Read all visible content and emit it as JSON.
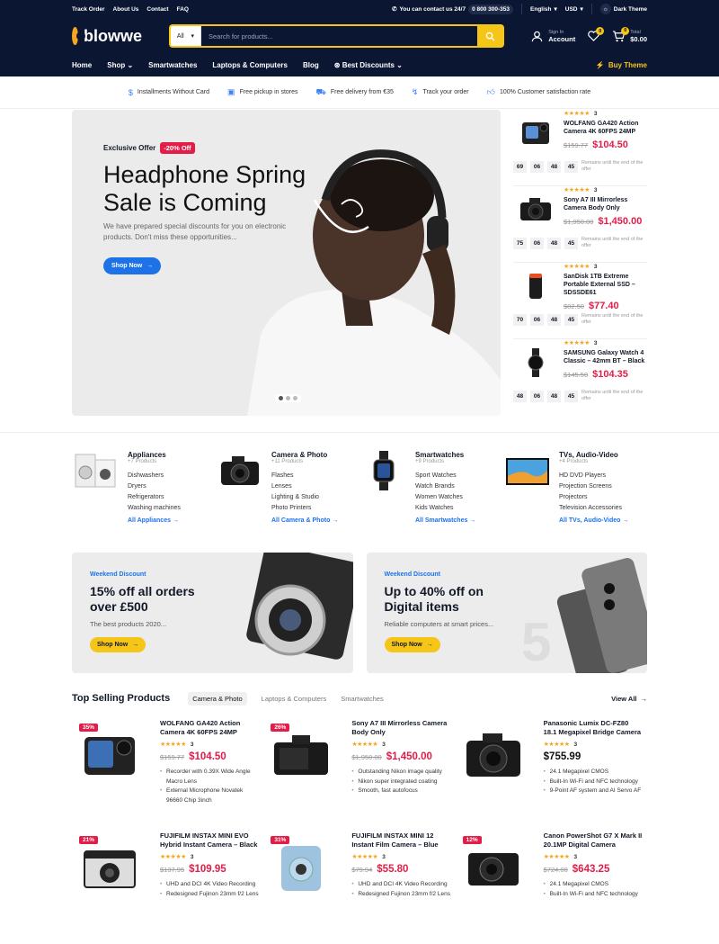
{
  "topbar": {
    "links": [
      "Track Order",
      "About Us",
      "Contact",
      "FAQ"
    ],
    "contact_text": "You can contact us 24/7",
    "phone": "0 800 300-353",
    "language": "English",
    "currency": "USD",
    "theme": "Dark Theme"
  },
  "header": {
    "logo": "blowwe",
    "search_category": "All",
    "search_placeholder": "Search for products...",
    "signin_small": "Sign In",
    "signin_big": "Account",
    "wishlist_count": "0",
    "cart_count": "0",
    "total_label": "Total",
    "total_value": "$0.00"
  },
  "nav": {
    "items": [
      "Home",
      "Shop",
      "Smartwatches",
      "Laptops & Computers",
      "Blog",
      "Best Discounts"
    ],
    "buy_theme": "Buy Theme"
  },
  "features": [
    "Installments Without Card",
    "Free pickup in stores",
    "Free delivery from €35",
    "Track your order",
    "100% Customer satisfaction rate"
  ],
  "hero": {
    "offer_label": "Exclusive Offer",
    "offer_tag": "-20% Off",
    "title": "Headphone Spring Sale is Coming",
    "desc": "We have prepared special discounts for you on electronic products. Don't miss these opportunities...",
    "button": "Shop Now"
  },
  "deals": [
    {
      "rating": "3",
      "name": "WOLFANG GA420 Action Camera 4K 60FPS 24MP",
      "old": "$159.77",
      "new": "$104.50",
      "timer": [
        "69",
        "06",
        "48",
        "45"
      ],
      "remaining": "Remains until the end of the offer"
    },
    {
      "rating": "3",
      "name": "Sony A7 III Mirrorless Camera Body Only",
      "old": "$1,950.00",
      "new": "$1,450.00",
      "timer": [
        "75",
        "06",
        "48",
        "45"
      ],
      "remaining": "Remains until the end of the offer"
    },
    {
      "rating": "3",
      "name": "SanDisk 1TB Extreme Portable External SSD – SDSSDE61",
      "old": "$82.50",
      "new": "$77.40",
      "timer": [
        "70",
        "06",
        "48",
        "45"
      ],
      "remaining": "Remains until the end of the offer"
    },
    {
      "rating": "3",
      "name": "SAMSUNG Galaxy Watch 4 Classic – 42mm BT – Black",
      "old": "$145.50",
      "new": "$104.35",
      "timer": [
        "48",
        "06",
        "48",
        "45"
      ],
      "remaining": "Remains until the end of the offer"
    }
  ],
  "categories": [
    {
      "title": "Appliances",
      "count": "+7 Products",
      "items": [
        "Dishwashers",
        "Dryers",
        "Refrigerators",
        "Washing machines"
      ],
      "all": "All Appliances"
    },
    {
      "title": "Camera & Photo",
      "count": "+11 Products",
      "items": [
        "Flashes",
        "Lenses",
        "Lighting & Studio",
        "Photo Printers"
      ],
      "all": "All Camera & Photo"
    },
    {
      "title": "Smartwatches",
      "count": "+9 Products",
      "items": [
        "Sport Watches",
        "Watch Brands",
        "Women Watches",
        "Kids Watches"
      ],
      "all": "All Smartwatches"
    },
    {
      "title": "TVs, Audio-Video",
      "count": "+4 Products",
      "items": [
        "HD DVD Players",
        "Projection Screens",
        "Projectors",
        "Television Accessories"
      ],
      "all": "All TVs, Audio-Video"
    }
  ],
  "banners": [
    {
      "label": "Weekend Discount",
      "title": "15% off all orders over £500",
      "desc": "The best products 2020...",
      "button": "Shop Now"
    },
    {
      "label": "Weekend Discount",
      "title": "Up to 40% off on Digital items",
      "desc": "Reliable computers at smart prices...",
      "button": "Shop Now"
    }
  ],
  "top_selling": {
    "title": "Top Selling Products",
    "tabs": [
      "Camera & Photo",
      "Laptops & Computers",
      "Smartwatches"
    ],
    "view_all": "View All",
    "products": [
      {
        "discount": "35%",
        "name": "WOLFANG GA420 Action Camera 4K 60FPS 24MP",
        "rating": "3",
        "old": "$159.77",
        "new": "$104.50",
        "features": [
          "Recorder with 0.39X Wide Angle Macro Lens",
          "External Microphone Novatek 96660 Chip 3inch"
        ]
      },
      {
        "discount": "26%",
        "name": "Sony A7 III Mirrorless Camera Body Only",
        "rating": "3",
        "old": "$1,950.00",
        "new": "$1,450.00",
        "features": [
          "Outstanding Nikon image quality",
          "Nikon super integrated coating",
          "Smooth, fast autofocus"
        ]
      },
      {
        "discount": "",
        "name": "Panasonic Lumix DC-FZ80 18.1 Megapixel Bridge Camera",
        "rating": "3",
        "old": "",
        "new": "$755.99",
        "features": [
          "24.1 Megapixel CMOS",
          "Built-In Wi-Fi and NFC technology",
          "9-Point AF system and AI Servo AF"
        ]
      },
      {
        "discount": "21%",
        "name": "FUJIFILM INSTAX MINI EVO Hybrid Instant Camera – Black",
        "rating": "3",
        "old": "$137.95",
        "new": "$109.95",
        "features": [
          "UHD and DCI 4K Video Recording",
          "Redesigned Fujinon 23mm f/2 Lens"
        ]
      },
      {
        "discount": "31%",
        "name": "FUJIFILM INSTAX MINI 12 Instant Film Camera – Blue",
        "rating": "3",
        "old": "$79.94",
        "new": "$55.80",
        "features": [
          "UHD and DCI 4K Video Recording",
          "Redesigned Fujinon 23mm f/2 Lens"
        ]
      },
      {
        "discount": "12%",
        "name": "Canon PowerShot G7 X Mark II 20.1MP Digital Camera",
        "rating": "3",
        "old": "$724.00",
        "new": "$643.25",
        "features": [
          "24.1 Megapixel CMOS",
          "Built-In Wi-Fi and NFC technology"
        ]
      }
    ]
  },
  "colors": {
    "navy": "#0b1633",
    "accent": "#f5c518",
    "blue": "#1d72e8",
    "sale": "#e11d48"
  }
}
